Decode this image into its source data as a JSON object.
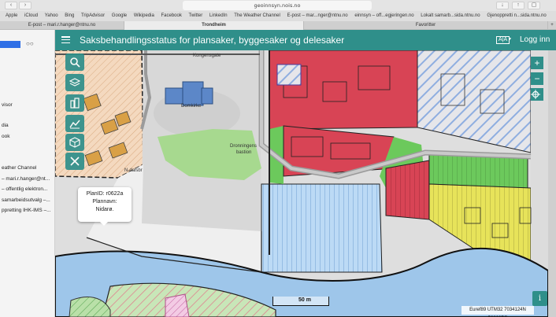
{
  "browser": {
    "url": "geoinnsyn.nois.no",
    "bookmarks": [
      "Apple",
      "iCloud",
      "Yahoo",
      "Bing",
      "TripAdvisor",
      "Google",
      "Wikipedia",
      "Facebook",
      "Twitter",
      "LinkedIn",
      "The Weather Channel",
      "E-post – mar...nger@ntnu.no",
      "einnsyn – off...egjeringen.no",
      "Lokalt samarb...sida.ntnu.no",
      "Gjenoppretti n...sida.ntnu.no"
    ],
    "tabs": [
      {
        "label": "E-post – mari.r.hanger@ntnu.no",
        "active": false
      },
      {
        "label": "Trondheim",
        "active": true
      },
      {
        "label": "Favoritter",
        "active": false
      }
    ],
    "new_tab_label": "+"
  },
  "sidebar": {
    "glasses_glyph": "○○",
    "items": [
      "visor",
      "dia",
      "ook",
      "eather Channel",
      "– mari.r.hanger@nt...",
      "– offentlig elektron...",
      "samarbeidsutvalg –...",
      "ppretting IHK-IMS –..."
    ]
  },
  "header": {
    "title": "Saksbehandlingsstatus for plansaker, byggesaker og delesaker",
    "language_label": "A|A",
    "login_label": "Logg inn"
  },
  "map": {
    "labels": {
      "street_top": "Kongensgate",
      "church": "Domkirke",
      "bastion_1": "Dronningens",
      "bastion_2": "bastion",
      "n_dalsbidl": "N-dalsbr"
    },
    "popup": {
      "line1": "PlanID: r0622a",
      "line2": "Plannavn:",
      "line3": "Nidarø."
    },
    "scale_label": "50 m",
    "coordinates": "Euref89 UTM32 7034124N 568607Ø",
    "info_label": "i",
    "zoom_in": "+",
    "zoom_out": "−",
    "colors": {
      "header": "#2f8f8a",
      "residential_red": "#d84455",
      "green_zone": "#6cc95c",
      "yellow_zone": "#e7e35a",
      "blue_hatch": "#9fc8ee",
      "water": "#9ec6ea"
    }
  }
}
